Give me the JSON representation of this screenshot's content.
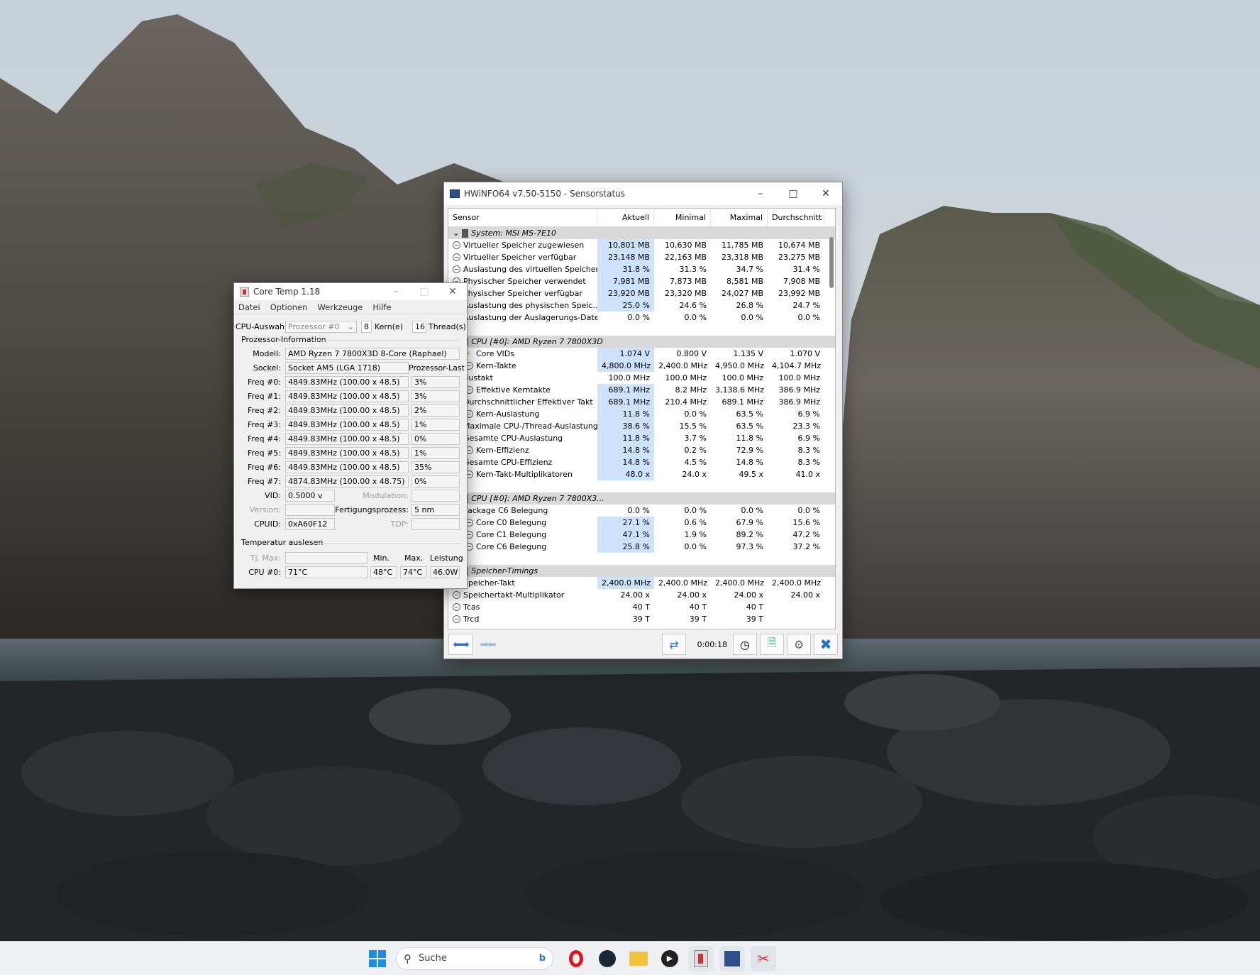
{
  "hwinfo": {
    "title": "HWiNFO64 v7.50-5150 - Sensorstatus",
    "columns": [
      "Sensor",
      "Aktuell",
      "Minimal",
      "Maximal",
      "Durchschnitt"
    ],
    "rows": [
      {
        "type": "group",
        "label": "System: MSI MS-7E10"
      },
      {
        "type": "row",
        "label": "Virtueller Speicher zugewiesen",
        "v": [
          "10,801 MB",
          "10,630 MB",
          "11,785 MB",
          "10,674 MB"
        ],
        "hl": true
      },
      {
        "type": "row",
        "label": "Virtueller Speicher verfügbar",
        "v": [
          "23,148 MB",
          "22,163 MB",
          "23,318 MB",
          "23,275 MB"
        ],
        "hl": true
      },
      {
        "type": "row",
        "label": "Auslastung des virtuellen Speichers",
        "v": [
          "31.8 %",
          "31.3 %",
          "34.7 %",
          "31.4 %"
        ],
        "hl": true
      },
      {
        "type": "row",
        "label": "Physischer Speicher verwendet",
        "v": [
          "7,981 MB",
          "7,873 MB",
          "8,581 MB",
          "7,908 MB"
        ],
        "hl": true
      },
      {
        "type": "row",
        "label": "Physischer Speicher verfügbar",
        "v": [
          "23,920 MB",
          "23,320 MB",
          "24,027 MB",
          "23,992 MB"
        ],
        "hl": true
      },
      {
        "type": "row",
        "label": "Auslastung des physischen Speic...",
        "v": [
          "25.0 %",
          "24.6 %",
          "26.8 %",
          "24.7 %"
        ],
        "hl": true
      },
      {
        "type": "row",
        "label": "Auslastung der Auslagerungs-Datei",
        "v": [
          "0.0 %",
          "0.0 %",
          "0.0 %",
          "0.0 %"
        ]
      },
      {
        "type": "blank"
      },
      {
        "type": "group",
        "label": "CPU [#0]: AMD Ryzen 7 7800X3D"
      },
      {
        "type": "row",
        "label": "Core VIDs",
        "v": [
          "1.074 V",
          "0.800 V",
          "1.135 V",
          "1.070 V"
        ],
        "hl": true,
        "sub": true,
        "icon": "bolt"
      },
      {
        "type": "row",
        "label": "Kern-Takte",
        "v": [
          "4,800.0 MHz",
          "2,400.0 MHz",
          "4,950.0 MHz",
          "4,104.7 MHz"
        ],
        "hl": true,
        "sub": true
      },
      {
        "type": "row",
        "label": "Bustakt",
        "v": [
          "100.0 MHz",
          "100.0 MHz",
          "100.0 MHz",
          "100.0 MHz"
        ]
      },
      {
        "type": "row",
        "label": "Effektive Kerntakte",
        "v": [
          "689.1 MHz",
          "8.2 MHz",
          "3,138.6 MHz",
          "386.9 MHz"
        ],
        "hl": true,
        "sub": true
      },
      {
        "type": "row",
        "label": "Durchschnittlicher Effektiver Takt",
        "v": [
          "689.1 MHz",
          "210.4 MHz",
          "689.1 MHz",
          "386.9 MHz"
        ],
        "hl": true
      },
      {
        "type": "row",
        "label": "Kern-Auslastung",
        "v": [
          "11.8 %",
          "0.0 %",
          "63.5 %",
          "6.9 %"
        ],
        "hl": true,
        "sub": true
      },
      {
        "type": "row",
        "label": "Maximale CPU-/Thread-Auslastung",
        "v": [
          "38.6 %",
          "15.5 %",
          "63.5 %",
          "23.3 %"
        ],
        "hl": true
      },
      {
        "type": "row",
        "label": "Gesamte CPU-Auslastung",
        "v": [
          "11.8 %",
          "3.7 %",
          "11.8 %",
          "6.9 %"
        ],
        "hl": true
      },
      {
        "type": "row",
        "label": "Kern-Effizienz",
        "v": [
          "14.8 %",
          "0.2 %",
          "72.9 %",
          "8.3 %"
        ],
        "hl": true,
        "sub": true
      },
      {
        "type": "row",
        "label": "Gesamte CPU-Effizienz",
        "v": [
          "14.8 %",
          "4.5 %",
          "14.8 %",
          "8.3 %"
        ],
        "hl": true
      },
      {
        "type": "row",
        "label": "Kern-Takt-Multiplikatoren",
        "v": [
          "48.0 x",
          "24.0 x",
          "49.5 x",
          "41.0 x"
        ],
        "hl": true,
        "sub": true
      },
      {
        "type": "blank"
      },
      {
        "type": "group",
        "label": "CPU [#0]: AMD Ryzen 7 7800X3..."
      },
      {
        "type": "row",
        "label": "Package C6 Belegung",
        "v": [
          "0.0 %",
          "0.0 %",
          "0.0 %",
          "0.0 %"
        ]
      },
      {
        "type": "row",
        "label": "Core C0 Belegung",
        "v": [
          "27.1 %",
          "0.6 %",
          "67.9 %",
          "15.6 %"
        ],
        "hl": true,
        "sub": true
      },
      {
        "type": "row",
        "label": "Core C1 Belegung",
        "v": [
          "47.1 %",
          "1.9 %",
          "89.2 %",
          "47.2 %"
        ],
        "hl": true,
        "sub": true
      },
      {
        "type": "row",
        "label": "Core C6 Belegung",
        "v": [
          "25.8 %",
          "0.0 %",
          "97.3 %",
          "37.2 %"
        ],
        "hl": true,
        "sub": true
      },
      {
        "type": "blank"
      },
      {
        "type": "group",
        "label": "Speicher-Timings"
      },
      {
        "type": "row",
        "label": "Speicher-Takt",
        "v": [
          "2,400.0 MHz",
          "2,400.0 MHz",
          "2,400.0 MHz",
          "2,400.0 MHz"
        ],
        "hl": true
      },
      {
        "type": "row",
        "label": "Speichertakt-Multiplikator",
        "v": [
          "24.00 x",
          "24.00 x",
          "24.00 x",
          "24.00 x"
        ]
      },
      {
        "type": "row",
        "label": "Tcas",
        "v": [
          "40 T",
          "40 T",
          "40 T",
          ""
        ]
      },
      {
        "type": "row",
        "label": "Trcd",
        "v": [
          "39 T",
          "39 T",
          "39 T",
          ""
        ]
      }
    ],
    "timer": "0:00:18"
  },
  "coretemp": {
    "title": "Core Temp 1.18",
    "menu": [
      "Datei",
      "Optionen",
      "Werkzeuge",
      "Hilfe"
    ],
    "cpu_select_label": "CPU-Auswahl:",
    "cpu_select_value": "Prozessor #0",
    "cores": "8",
    "cores_label": "Kern(e)",
    "threads": "16",
    "threads_label": "Thread(s)",
    "proc_info_title": "Prozessor-Information",
    "model_label": "Modell:",
    "model": "AMD Ryzen 7 7800X3D 8-Core (Raphael)",
    "socket_label": "Sockel:",
    "socket": "Socket AM5 (LGA 1718)",
    "load_label": "Prozessor-Last",
    "freqs": [
      {
        "label": "Freq #0:",
        "value": "4849.83MHz (100.00 x 48.5)",
        "load": "3%"
      },
      {
        "label": "Freq #1:",
        "value": "4849.83MHz (100.00 x 48.5)",
        "load": "3%"
      },
      {
        "label": "Freq #2:",
        "value": "4849.83MHz (100.00 x 48.5)",
        "load": "2%"
      },
      {
        "label": "Freq #3:",
        "value": "4849.83MHz (100.00 x 48.5)",
        "load": "1%"
      },
      {
        "label": "Freq #4:",
        "value": "4849.83MHz (100.00 x 48.5)",
        "load": "0%"
      },
      {
        "label": "Freq #5:",
        "value": "4849.83MHz (100.00 x 48.5)",
        "load": "1%"
      },
      {
        "label": "Freq #6:",
        "value": "4849.83MHz (100.00 x 48.5)",
        "load": "35%"
      },
      {
        "label": "Freq #7:",
        "value": "4874.83MHz (100.00 x 48.75)",
        "load": "0%"
      }
    ],
    "vid_label": "VID:",
    "vid": "0.5000 v",
    "modulation_label": "Modulation:",
    "version_label": "Version:",
    "process_label": "Fertigungsprozess:",
    "process": "5 nm",
    "cpuid_label": "CPUID:",
    "cpuid": "0xA60F12",
    "tdp_label": "TDP:",
    "temp_title": "Temperatur auslesen",
    "tjmax_label": "Tj. Max:",
    "min_label": "Min.",
    "max_label": "Max.",
    "power_label": "Leistung",
    "cpu0_label": "CPU #0:",
    "cpu0_temp": "71°C",
    "cpu0_min": "48°C",
    "cpu0_max": "74°C",
    "cpu0_power": "46.0W"
  },
  "taskbar": {
    "search_placeholder": "Suche"
  }
}
